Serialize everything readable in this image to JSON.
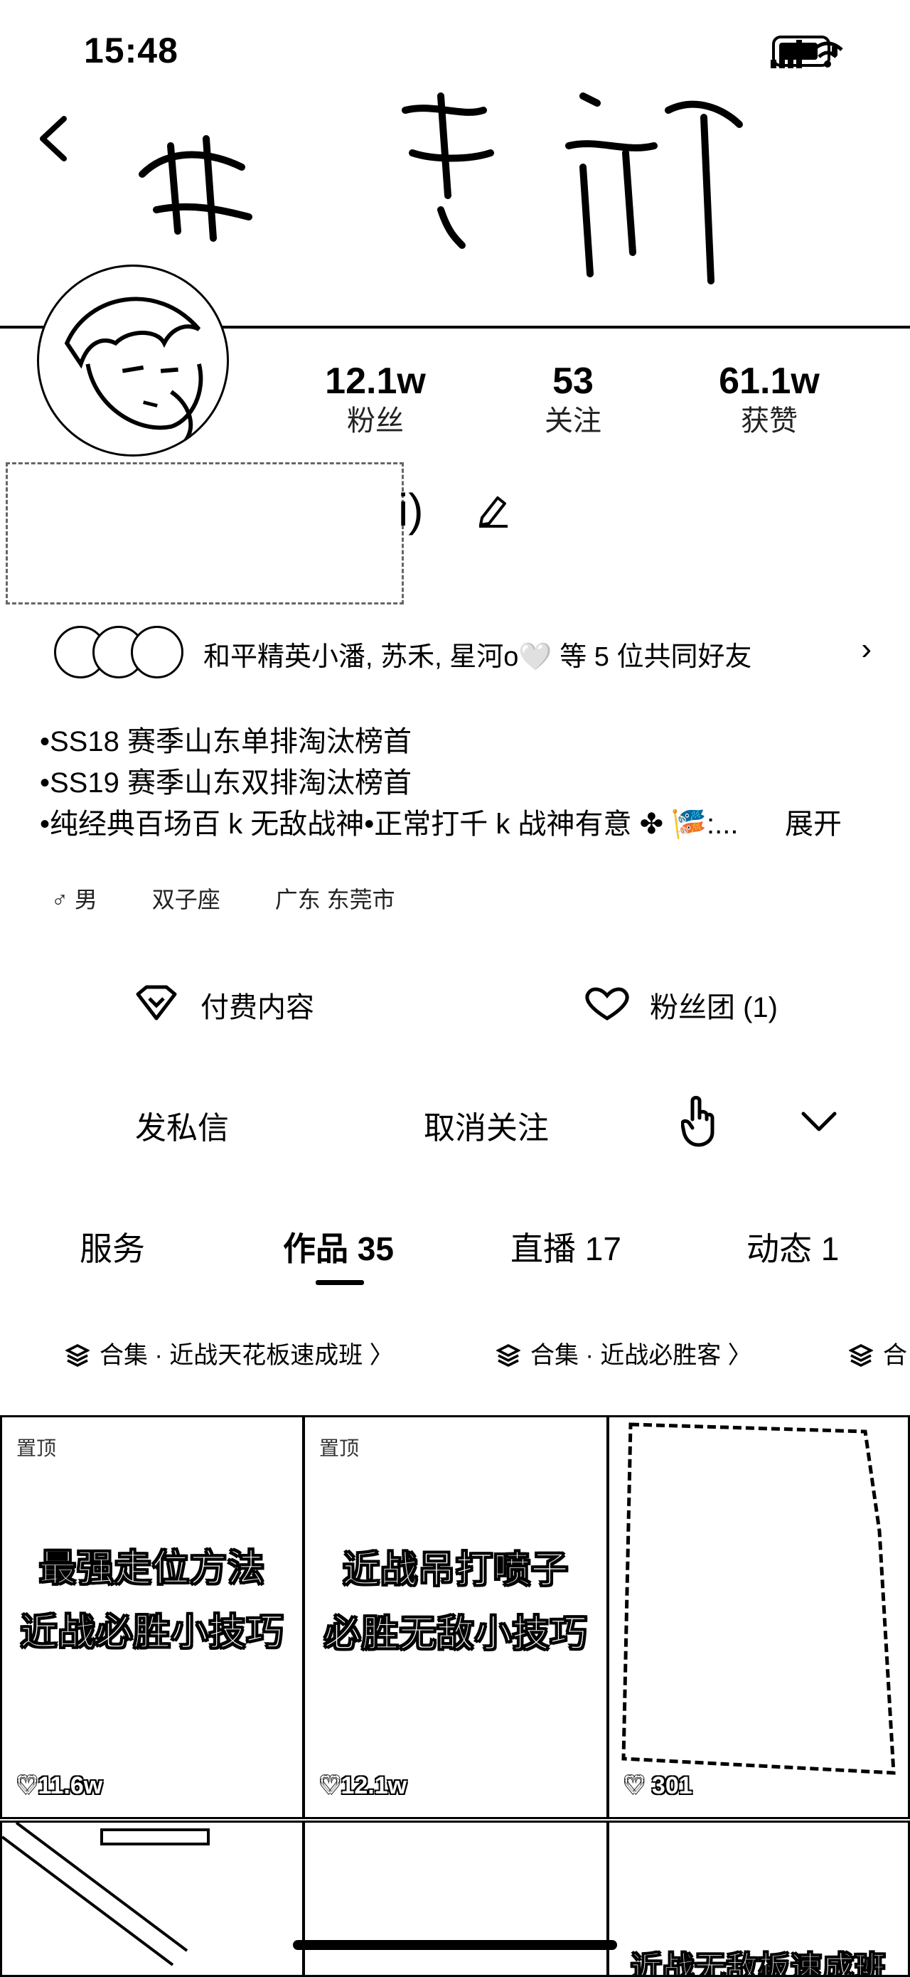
{
  "status_bar": {
    "time": "15:48"
  },
  "profile": {
    "stats": [
      {
        "value": "12.1w",
        "label": "粉丝"
      },
      {
        "value": "53",
        "label": "关注"
      },
      {
        "value": "61.1w",
        "label": "获赞"
      }
    ],
    "name_tail": "i)",
    "friends_text": "和平精英小潘, 苏禾, 星河o🤍 等 5 位共同好友",
    "bio": [
      "•SS18 赛季山东单排淘汰榜首",
      "•SS19 赛季山东双排淘汰榜首",
      "•纯经典百场百 k 无敌战神•正常打千 k 战神有意 ✤ 🎏:..."
    ],
    "expand_label": "展开",
    "tags": [
      "♂ 男",
      "双子座",
      "广东 东莞市"
    ]
  },
  "services": {
    "paid_label": "付费内容",
    "fan_group_label": "粉丝团 (1)"
  },
  "actions": {
    "message_label": "发私信",
    "unfollow_label": "取消关注"
  },
  "tabs": [
    {
      "label": "服务"
    },
    {
      "label": "作品 35"
    },
    {
      "label": "直播 17"
    },
    {
      "label": "动态 1"
    }
  ],
  "collections": [
    {
      "label": "合集 · 近战天花板速成班 〉"
    },
    {
      "label": "合集 · 近战必胜客 〉"
    },
    {
      "label": "合"
    }
  ],
  "videos": [
    {
      "pinned": "置顶",
      "line1": "最强走位方法",
      "line2": "近战必胜小技巧",
      "likes": "♡11.6w"
    },
    {
      "pinned": "置顶",
      "line1": "近战吊打喷子",
      "line2": "必胜无敌小技巧",
      "likes": "♡12.1w"
    },
    {
      "likes": "♡ 301"
    }
  ],
  "bottom_row": {
    "partial_title": "近战无敌板速成班"
  }
}
